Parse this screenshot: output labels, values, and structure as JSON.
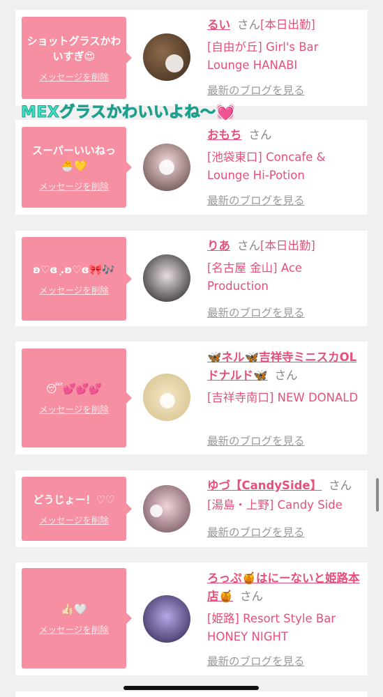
{
  "colors": {
    "accent": "#e5507a",
    "bubble": "#f78fa2",
    "overlay_text": "#3ee0c4"
  },
  "overlay_caption": "MEXグラスかわいいよね〜",
  "overlay_heart": "💓",
  "cards": [
    {
      "message": "ショットグラスかわいすぎ😍",
      "delete_label": "メッセージを削除",
      "cast_name": "るい",
      "honorific": "さん",
      "status_tag": "[本日出勤]",
      "shop": "[自由が丘] Girl's Bar Lounge HANABI",
      "blog_link": "最新のブログを見る"
    },
    {
      "message": "スーパーいいねっ🐣💛",
      "delete_label": "メッセージを削除",
      "cast_name": "おもち",
      "honorific": "さん",
      "status_tag": "",
      "shop": "[池袋東口] Concafe & Lounge Hi-Potion",
      "blog_link": "最新のブログを見る"
    },
    {
      "message": "ʚ♡ɞ ͙.ʚ♡ɞ🎀🎶",
      "delete_label": "メッセージを削除",
      "cast_name": "りあ",
      "honorific": "さん",
      "status_tag": "[本日出勤]",
      "shop": "[名古屋 金山] Ace Production",
      "blog_link": "最新のブログを見る"
    },
    {
      "message": "😴💕💕💕",
      "delete_label": "メッセージを削除",
      "cast_name": "🦋ネル🦋吉祥寺ミニスカOLドナルド🦋",
      "honorific": "さん",
      "status_tag": "",
      "shop": "[吉祥寺南口] NEW DONALD",
      "blog_link": "最新のブログを見る"
    },
    {
      "message": "どうじょー！♡♡",
      "delete_label": "メッセージを削除",
      "cast_name": "ゆづ【CandySide】",
      "honorific": "さん",
      "status_tag": "",
      "shop": "[湯島・上野] Candy Side",
      "blog_link": "最新のブログを見る"
    },
    {
      "message": "👍🏻🤍",
      "delete_label": "メッセージを削除",
      "cast_name": "ろっぷ🍯はにーないと姫路本店🍯",
      "honorific": "さん",
      "status_tag": "",
      "shop": "[姫路] Resort Style Bar HONEY NIGHT",
      "blog_link": "最新のブログを見る"
    }
  ]
}
